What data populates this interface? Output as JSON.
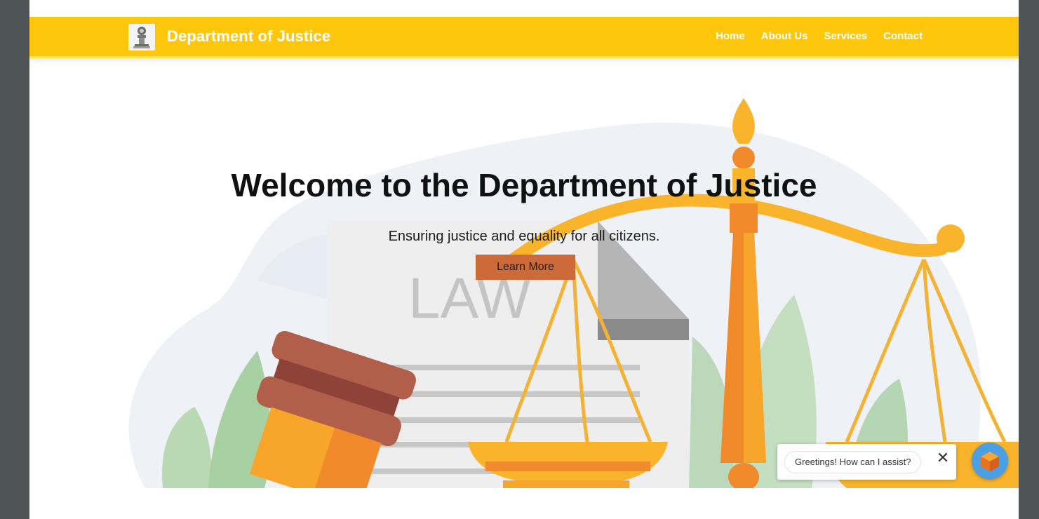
{
  "navbar": {
    "brand": "Department of Justice",
    "links": [
      {
        "label": "Home"
      },
      {
        "label": "About Us"
      },
      {
        "label": "Services"
      },
      {
        "label": "Contact"
      }
    ]
  },
  "hero": {
    "title": "Welcome to the Department of Justice",
    "subtitle": "Ensuring justice and equality for all citizens.",
    "button_label": "Learn More",
    "illustration_text": "LAW"
  },
  "chat": {
    "greeting": "Greetings! How can I assist?",
    "close_symbol": "✕"
  },
  "colors": {
    "navbar": "#fec70c",
    "button": "#cd6a3a",
    "chat_launcher": "#4a9fe5"
  },
  "icons": {
    "logo": "emblem-icon",
    "chat_launcher": "cube-icon",
    "close": "close-icon"
  }
}
